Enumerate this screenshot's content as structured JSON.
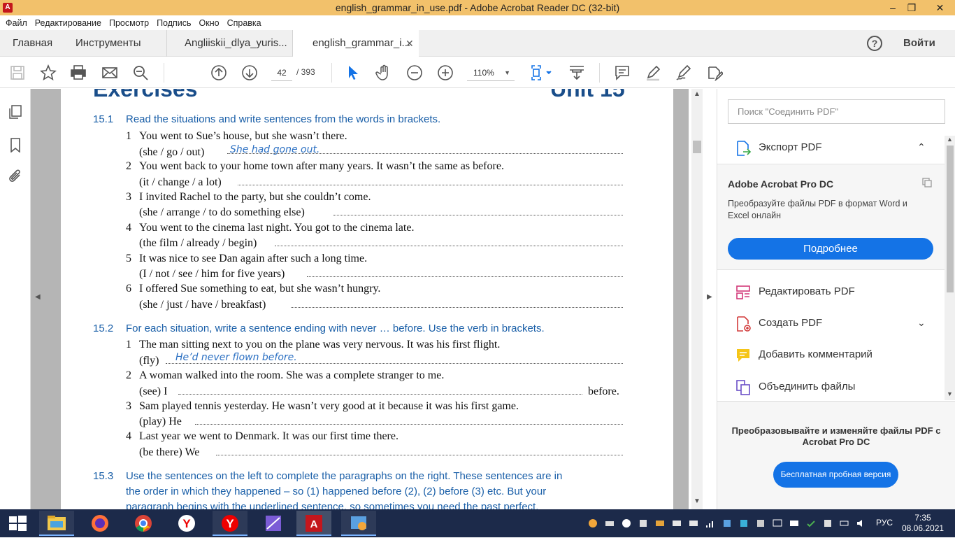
{
  "window": {
    "title": "english_grammar_in_use.pdf - Adobe Acrobat Reader DC (32-bit)",
    "minimize": "‒",
    "maximize": "❐",
    "close": "✕"
  },
  "menu": [
    "Файл",
    "Редактирование",
    "Просмотр",
    "Подпись",
    "Окно",
    "Справка"
  ],
  "tabs": {
    "home": "Главная",
    "tools": "Инструменты",
    "doc1": "Angliiskii_dlya_yuris...",
    "doc2": "english_grammar_i...",
    "close_glyph": "✕",
    "help_glyph": "?",
    "login": "Войти"
  },
  "toolbar": {
    "page_current": "42",
    "page_total": "/   393",
    "zoom": "110%",
    "zoom_caret": "▼"
  },
  "document": {
    "heading_partial": "Exercises",
    "unit_partial": "Unit 15",
    "sections": [
      {
        "num": "15.1",
        "title": "Read the situations and write sentences from the words in brackets.",
        "items": [
          {
            "n": "1",
            "text": "You went to Sue’s house, but she wasn’t there.",
            "sub": "(she / go / out)",
            "answer": "She had gone out."
          },
          {
            "n": "2",
            "text": "You went back to your home town after many years. It wasn’t the same as before.",
            "sub": "(it / change / a lot)",
            "answer": ""
          },
          {
            "n": "3",
            "text": "I invited Rachel to the party, but she couldn’t come.",
            "sub": "(she / arrange / to do something else)",
            "answer": ""
          },
          {
            "n": "4",
            "text": "You went to the cinema last night. You got to the cinema late.",
            "sub": "(the film / already / begin)",
            "answer": ""
          },
          {
            "n": "5",
            "text": "It was nice to see Dan again after such a long time.",
            "sub": "(I / not / see / him for five years)",
            "answer": ""
          },
          {
            "n": "6",
            "text": "I offered Sue something to eat, but she wasn’t hungry.",
            "sub": "(she / just / have / breakfast)",
            "answer": ""
          }
        ]
      },
      {
        "num": "15.2",
        "title": "For each situation, write a sentence ending with never … before. Use the verb in brackets.",
        "items": [
          {
            "n": "1",
            "text": "The man sitting next to you on the plane was very nervous. It was his first flight.",
            "sub": "(fly)",
            "answer": "He’d never flown before."
          },
          {
            "n": "2",
            "text": "A woman walked into the room. She was a complete stranger to me.",
            "sub": "(see)  I",
            "answer": "",
            "tail": "before."
          },
          {
            "n": "3",
            "text": "Sam played tennis yesterday. He wasn’t very good at it because it was his first game.",
            "sub": "(play)  He",
            "answer": ""
          },
          {
            "n": "4",
            "text": "Last year we went to Denmark. It was our first time there.",
            "sub": "(be there)  We",
            "answer": ""
          }
        ]
      },
      {
        "num": "15.3",
        "lines": [
          "Use the sentences on the left to complete the paragraphs on the right. These sentences are in",
          "the order in which they happened – so (1) happened before (2), (2) before (3) etc. But your",
          "paragraph begins with the underlined sentence, so sometimes you need the past perfect."
        ]
      }
    ]
  },
  "right_panel": {
    "search_placeholder": "Поиск \"Соединить PDF\"",
    "export": "Экспорт PDF",
    "promo_title": "Adobe Acrobat Pro DC",
    "promo_desc": "Преобразуйте файлы PDF в формат Word и Excel онлайн",
    "promo_button": "Подробнее",
    "edit": "Редактировать PDF",
    "create": "Создать PDF",
    "comment": "Добавить комментарий",
    "combine": "Объединить файлы",
    "bottom_msg": "Преобразовывайте и изменяйте файлы PDF с Acrobat Pro DC",
    "trial_button": "Бесплатная пробная версия",
    "chev_up": "⌃",
    "chev_down": "⌄"
  },
  "taskbar": {
    "lang": "РУС",
    "time": "7:35",
    "date": "08.06.2021"
  },
  "colors": {
    "titlebar": "#f2c16b",
    "accent_blue": "#1473e6",
    "heading_blue": "#1a5fa8",
    "handwriting": "#2a6fc2",
    "taskbar": "#1c2a4a"
  }
}
